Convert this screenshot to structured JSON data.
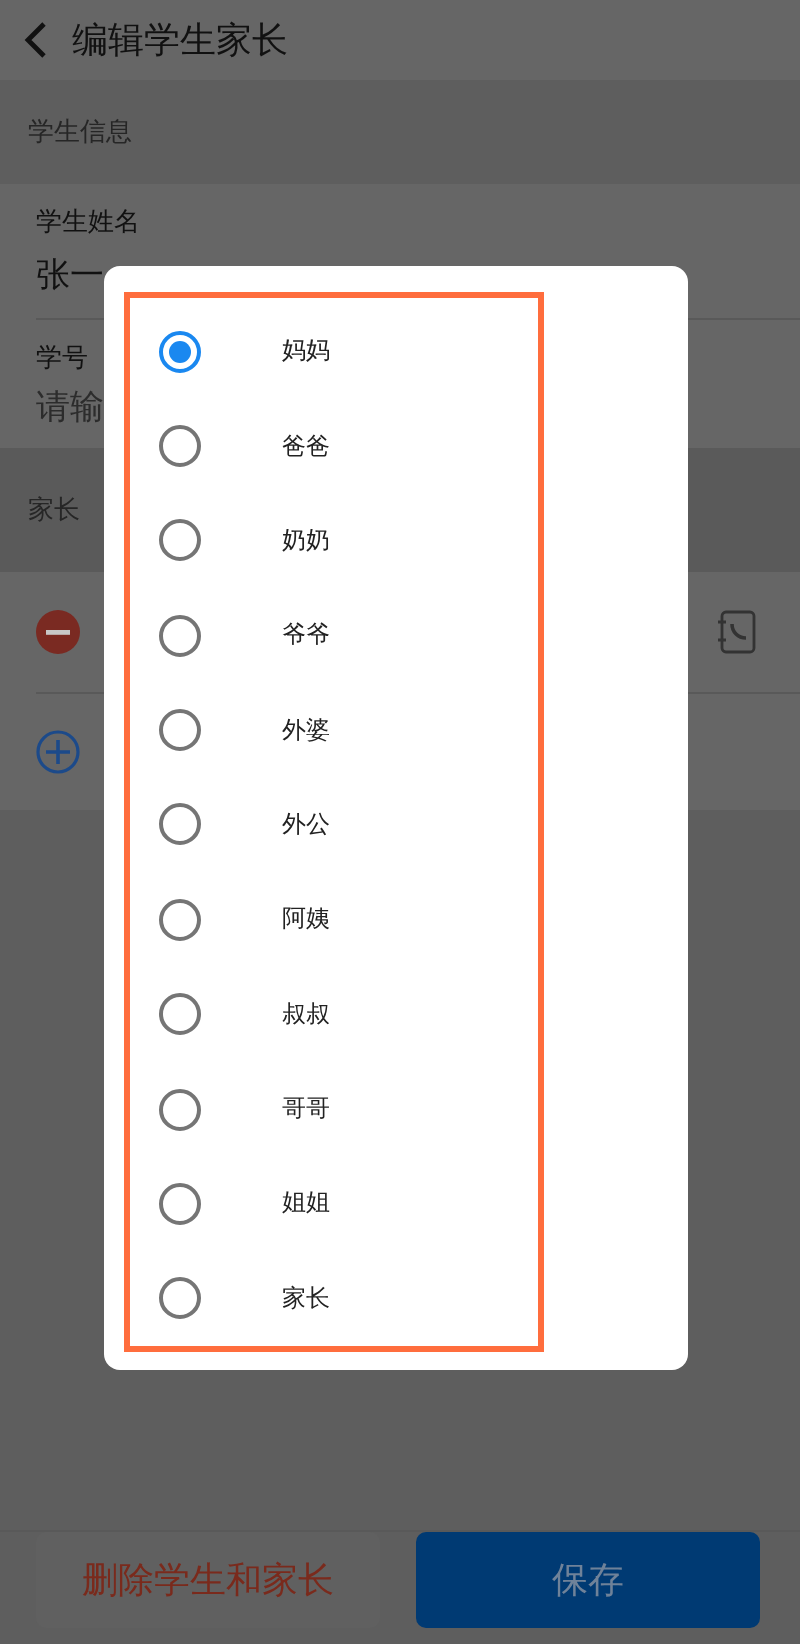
{
  "header": {
    "title": "编辑学生家长"
  },
  "student_section": {
    "title": "学生信息",
    "fields": [
      {
        "label": "学生姓名",
        "value": "张一"
      },
      {
        "label": "学号",
        "placeholder": "请输"
      }
    ]
  },
  "parent_section": {
    "title": "家长"
  },
  "buttons": [
    {
      "label": "删除学生和家长",
      "kind": "danger"
    },
    {
      "label": "保存",
      "kind": "primary"
    }
  ],
  "dialog": {
    "options": [
      {
        "label": "妈妈",
        "selected": true
      },
      {
        "label": "爸爸",
        "selected": false
      },
      {
        "label": "奶奶",
        "selected": false
      },
      {
        "label": "爷爷",
        "selected": false
      },
      {
        "label": "外婆",
        "selected": false
      },
      {
        "label": "外公",
        "selected": false
      },
      {
        "label": "阿姨",
        "selected": false
      },
      {
        "label": "叔叔",
        "selected": false
      },
      {
        "label": "哥哥",
        "selected": false
      },
      {
        "label": "姐姐",
        "selected": false
      },
      {
        "label": "家长",
        "selected": false
      }
    ]
  }
}
